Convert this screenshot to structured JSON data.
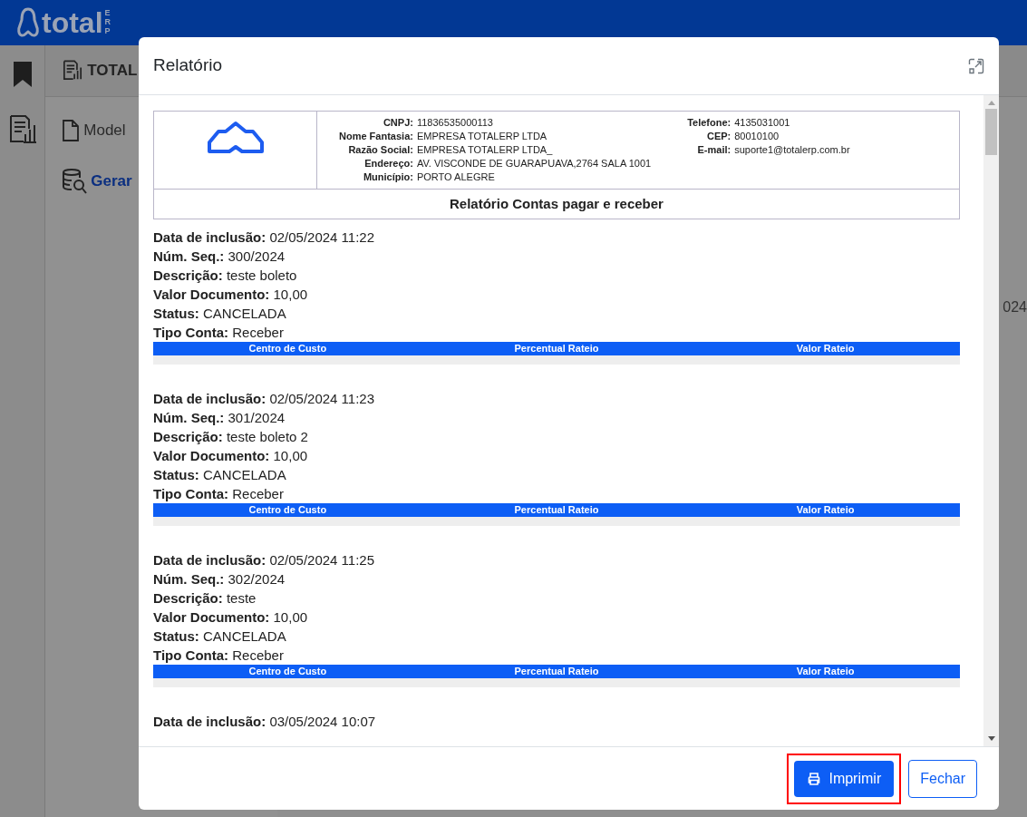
{
  "app": {
    "logo_text": "total",
    "logo_badge": "ERP",
    "panel_title": "TOTAL",
    "menu": [
      {
        "label": "Model",
        "selected": false
      },
      {
        "label": "Gerar",
        "selected": true
      }
    ],
    "cut_cell": "024"
  },
  "modal": {
    "title": "Relatório",
    "company": {
      "left": [
        {
          "label": "CNPJ:",
          "value": "11836535000113"
        },
        {
          "label": "Nome Fantasia:",
          "value": "EMPRESA TOTALERP LTDA"
        },
        {
          "label": "Razão Social:",
          "value": "EMPRESA TOTALERP LTDA_"
        },
        {
          "label": "Endereço:",
          "value": "AV. VISCONDE DE GUARAPUAVA,2764 SALA 1001"
        },
        {
          "label": "Município:",
          "value": "PORTO ALEGRE"
        }
      ],
      "right": [
        {
          "label": "Telefone:",
          "value": "4135031001"
        },
        {
          "label": "CEP:",
          "value": "80010100"
        },
        {
          "label": "E-mail:",
          "value": "suporte1@totalerp.com.br"
        }
      ]
    },
    "report_title": "Relatório Contas pagar e receber",
    "records": [
      {
        "fields": [
          {
            "label": "Data de inclusão:",
            "value": "02/05/2024 11:22"
          },
          {
            "label": "Núm. Seq.:",
            "value": "300/2024"
          },
          {
            "label": "Descrição:",
            "value": "teste boleto"
          },
          {
            "label": "Valor Documento:",
            "value": "10,00"
          },
          {
            "label": "Status:",
            "value": "CANCELADA"
          },
          {
            "label": "Tipo Conta:",
            "value": "Receber"
          }
        ],
        "columns": [
          "Centro de Custo",
          "Percentual Rateio",
          "Valor Rateio"
        ]
      },
      {
        "fields": [
          {
            "label": "Data de inclusão:",
            "value": "02/05/2024 11:23"
          },
          {
            "label": "Núm. Seq.:",
            "value": "301/2024"
          },
          {
            "label": "Descrição:",
            "value": "teste boleto 2"
          },
          {
            "label": "Valor Documento:",
            "value": "10,00"
          },
          {
            "label": "Status:",
            "value": "CANCELADA"
          },
          {
            "label": "Tipo Conta:",
            "value": "Receber"
          }
        ],
        "columns": [
          "Centro de Custo",
          "Percentual Rateio",
          "Valor Rateio"
        ]
      },
      {
        "fields": [
          {
            "label": "Data de inclusão:",
            "value": "02/05/2024 11:25"
          },
          {
            "label": "Núm. Seq.:",
            "value": "302/2024"
          },
          {
            "label": "Descrição:",
            "value": "teste"
          },
          {
            "label": "Valor Documento:",
            "value": "10,00"
          },
          {
            "label": "Status:",
            "value": "CANCELADA"
          },
          {
            "label": "Tipo Conta:",
            "value": "Receber"
          }
        ],
        "columns": [
          "Centro de Custo",
          "Percentual Rateio",
          "Valor Rateio"
        ]
      },
      {
        "fields": [
          {
            "label": "Data de inclusão:",
            "value": "03/05/2024 10:07"
          }
        ]
      }
    ],
    "buttons": [
      {
        "label": "Imprimir",
        "kind": "primary",
        "highlighted": true
      },
      {
        "label": "Fechar",
        "kind": "outline",
        "highlighted": false
      }
    ]
  }
}
